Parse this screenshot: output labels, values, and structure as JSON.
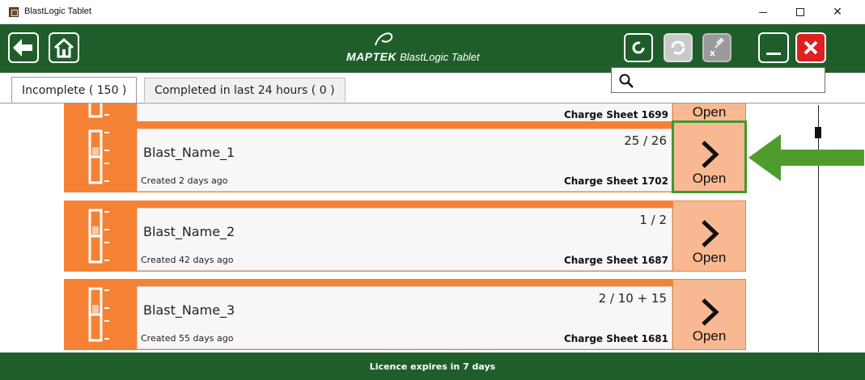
{
  "window": {
    "title": "BlastLogic Tablet",
    "controls": {
      "minimize": "–",
      "maximize": "□",
      "close": "✕"
    }
  },
  "header": {
    "logo_brand": "MAPTEK",
    "logo_product": "BlastLogic Tablet",
    "colors": {
      "bar": "#1f5e2b",
      "exit": "#e02020"
    },
    "buttons": [
      "back-arrow-icon",
      "home-icon",
      "refresh-icon",
      "sync-icon",
      "disconnect-icon",
      "minimize-icon",
      "close-icon"
    ]
  },
  "tabs": [
    {
      "label": "Incomplete ( 150 )",
      "selected": true
    },
    {
      "label": "Completed in last 24 hours ( 0 )",
      "selected": false
    }
  ],
  "search": {
    "value": "",
    "placeholder": ""
  },
  "cards": [
    {
      "name": "",
      "created": "",
      "progress": "",
      "sheet": "Charge Sheet 1699",
      "open_label": "Open"
    },
    {
      "name": "Blast_Name_1",
      "created": "Created 2 days ago",
      "progress": "25 / 26",
      "sheet": "Charge Sheet 1702",
      "open_label": "Open"
    },
    {
      "name": "Blast_Name_2",
      "created": "Created 42 days ago",
      "progress": "1 / 2",
      "sheet": "Charge Sheet 1687",
      "open_label": "Open"
    },
    {
      "name": "Blast_Name_3",
      "created": "Created 55 days ago",
      "progress": "2 / 10 + 15",
      "sheet": "Charge Sheet 1681",
      "open_label": "Open"
    }
  ],
  "colors": {
    "card": "#f58234",
    "open_button": "#f8b992",
    "highlight": "#3f9a2f"
  },
  "footer": {
    "licence": "Licence expires in 7 days"
  }
}
